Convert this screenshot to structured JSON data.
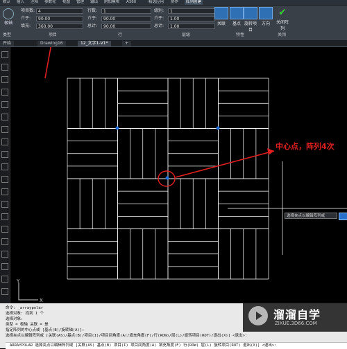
{
  "menu": {
    "items": [
      "默认",
      "插入",
      "注释",
      "参数化",
      "视图",
      "管理",
      "输出",
      "附加模块",
      "A360",
      "精选应用",
      "协作",
      "阵列创建"
    ],
    "active_index": 11
  },
  "ribbon": {
    "panel_labels": [
      "类型",
      "项目",
      "行",
      "层级",
      "特性",
      "关闭"
    ],
    "left_tool_label": "极轴",
    "items_fields": [
      {
        "label": "项目数:",
        "value": "4"
      },
      {
        "label": "介于:",
        "value": "90.00"
      },
      {
        "label": "填充:",
        "value": "360.00"
      }
    ],
    "row_fields": [
      {
        "label": "行数:",
        "value": "1"
      },
      {
        "label": "介于:",
        "value": "90.00"
      },
      {
        "label": "总计:",
        "value": "90.00"
      }
    ],
    "level_fields": [
      {
        "label": "级别:",
        "value": "1"
      },
      {
        "label": "介于:",
        "value": "1.00"
      },
      {
        "label": "总计:",
        "value": "1.00"
      }
    ],
    "buttons": [
      "关联",
      "基点",
      "旋转项目",
      "方向",
      "关闭阵列"
    ]
  },
  "tabs": [
    "开始",
    "Drawing16",
    "12_文字1-V1*",
    "+"
  ],
  "annotation": {
    "text": "中心点，阵列4次",
    "color": "#e02020"
  },
  "tooltip": {
    "text": "选择夹点以编辑阵列或"
  },
  "command_history": [
    "命令: _arraypolar",
    "选择对象: 找到 1 个",
    "选择对象:",
    "类型 = 极轴  关联 = 是",
    "指定阵列的中心点或 [基点(B)/旋转轴(A)]:",
    "选择夹点以编辑阵列或 [关联(AS)/基点(B)/项目(I)/项目间角度(A)/填充角度(F)/行(ROW)/层(L)/旋转项目(ROT)/退出(X)] <退出>:"
  ],
  "command_line": "ARRAYPOLAR 选择夹点以编辑阵列或 [关联(AS) 基点(B) 项目(I) 项目间角度(A) 填充角度(F) 行(ROW) 层(L) 旋转项目(ROT) 退出(X)] <退出>:",
  "watermark": {
    "title": "溜溜自学",
    "url": "ZIXUE.3D66.COM"
  },
  "ucs": {
    "x": "X",
    "y": "Y"
  },
  "colors": {
    "grip": "#1e6fe0",
    "lines": "#ffffff",
    "annotation": "#e02020",
    "ribbon": "#3a4048"
  }
}
